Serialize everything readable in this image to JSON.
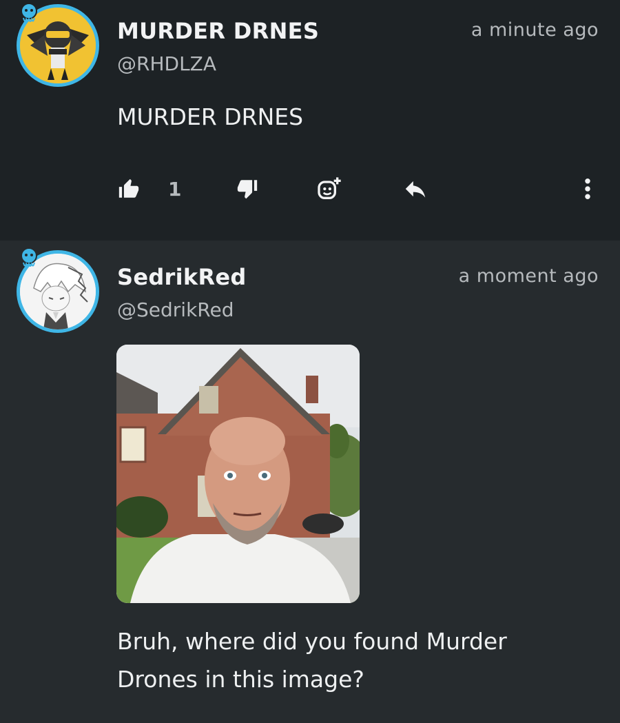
{
  "posts": [
    {
      "display_name": "MURDER DRNES",
      "handle": "@RHDLZA",
      "timestamp": "a minute ago",
      "text": "MURDER DRNES",
      "like_count": "1",
      "avatar_icon": "anime-character-avatar"
    },
    {
      "display_name": "SedrikRed",
      "handle": "@SedrikRed",
      "timestamp": "a moment ago",
      "text": "Bruh, where did you found Murder Drones in this image?",
      "avatar_icon": "anime-character-avatar"
    }
  ],
  "icons": {
    "like": "thumbs-up-icon",
    "dislike": "thumbs-down-icon",
    "react": "add-reaction-icon",
    "reply": "reply-icon",
    "more": "more-vertical-icon",
    "badge": "jellyfish-badge-icon"
  },
  "colors": {
    "background": "#212629",
    "avatar_ring": "#3fb6e6",
    "text_primary": "#f2f3f4",
    "text_secondary": "#b6babd"
  }
}
